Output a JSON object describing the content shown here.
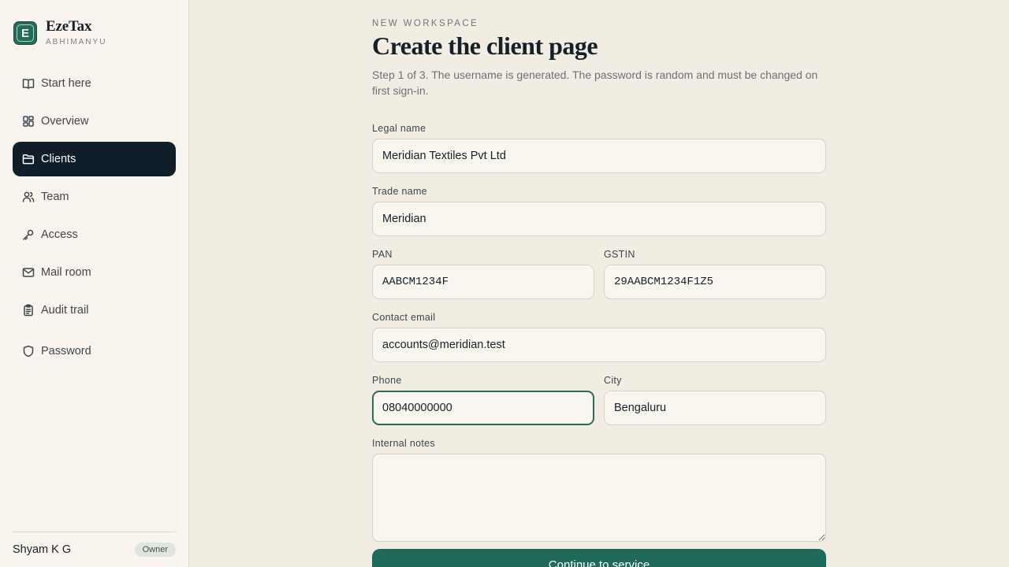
{
  "brand": {
    "logo_letter": "E",
    "name": "EzeTax",
    "subtitle": "ABHIMANYU"
  },
  "nav": [
    {
      "label": "Start here",
      "icon": "book-icon"
    },
    {
      "label": "Overview",
      "icon": "grid-icon"
    },
    {
      "label": "Clients",
      "icon": "folder-icon",
      "active": true
    },
    {
      "label": "Team",
      "icon": "users-icon"
    },
    {
      "label": "Access",
      "icon": "key-icon"
    },
    {
      "label": "Mail room",
      "icon": "mail-icon"
    },
    {
      "label": "Audit trail",
      "icon": "clipboard-icon"
    },
    {
      "label": "Password",
      "icon": "shield-icon"
    }
  ],
  "user": {
    "name": "Shyam K G",
    "role": "Owner"
  },
  "header": {
    "eyebrow": "NEW WORKSPACE",
    "title": "Create the client page",
    "subtitle": "Step 1 of 3. The username is generated. The password is random and must be changed on first sign-in."
  },
  "form": {
    "legal_name": {
      "label": "Legal name",
      "value": "Meridian Textiles Pvt Ltd"
    },
    "trade_name": {
      "label": "Trade name",
      "value": "Meridian"
    },
    "pan": {
      "label": "PAN",
      "value": "AABCM1234F"
    },
    "gstin": {
      "label": "GSTIN",
      "value": "29AABCM1234F1Z5"
    },
    "email": {
      "label": "Contact email",
      "value": "accounts@meridian.test"
    },
    "phone": {
      "label": "Phone",
      "value": "08040000000"
    },
    "city": {
      "label": "City",
      "value": "Bengaluru"
    },
    "notes": {
      "label": "Internal notes",
      "value": ""
    },
    "submit_label": "Continue to service"
  },
  "colors": {
    "accent": "#1f6b5a",
    "active_nav": "#101e29",
    "background": "#f1ede3",
    "sidebar": "#f9f5ee"
  }
}
